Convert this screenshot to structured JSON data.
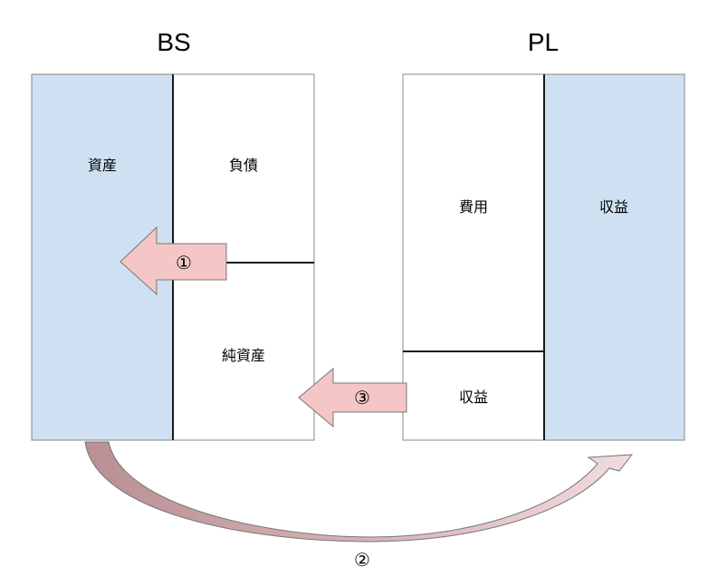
{
  "bs": {
    "title": "BS",
    "assets": "資産",
    "liabilities": "負債",
    "net_assets": "純資産"
  },
  "pl": {
    "title": "PL",
    "expenses": "費用",
    "revenue": "収益",
    "profit": "収益"
  },
  "arrows": {
    "arrow1": "①",
    "arrow2": "②",
    "arrow3": "③"
  },
  "colors": {
    "blue_fill": "#cfe0f2",
    "arrow_fill": "#f4c6c6",
    "curve_fill": "#c49a9e",
    "line": "#1a1a1a"
  }
}
